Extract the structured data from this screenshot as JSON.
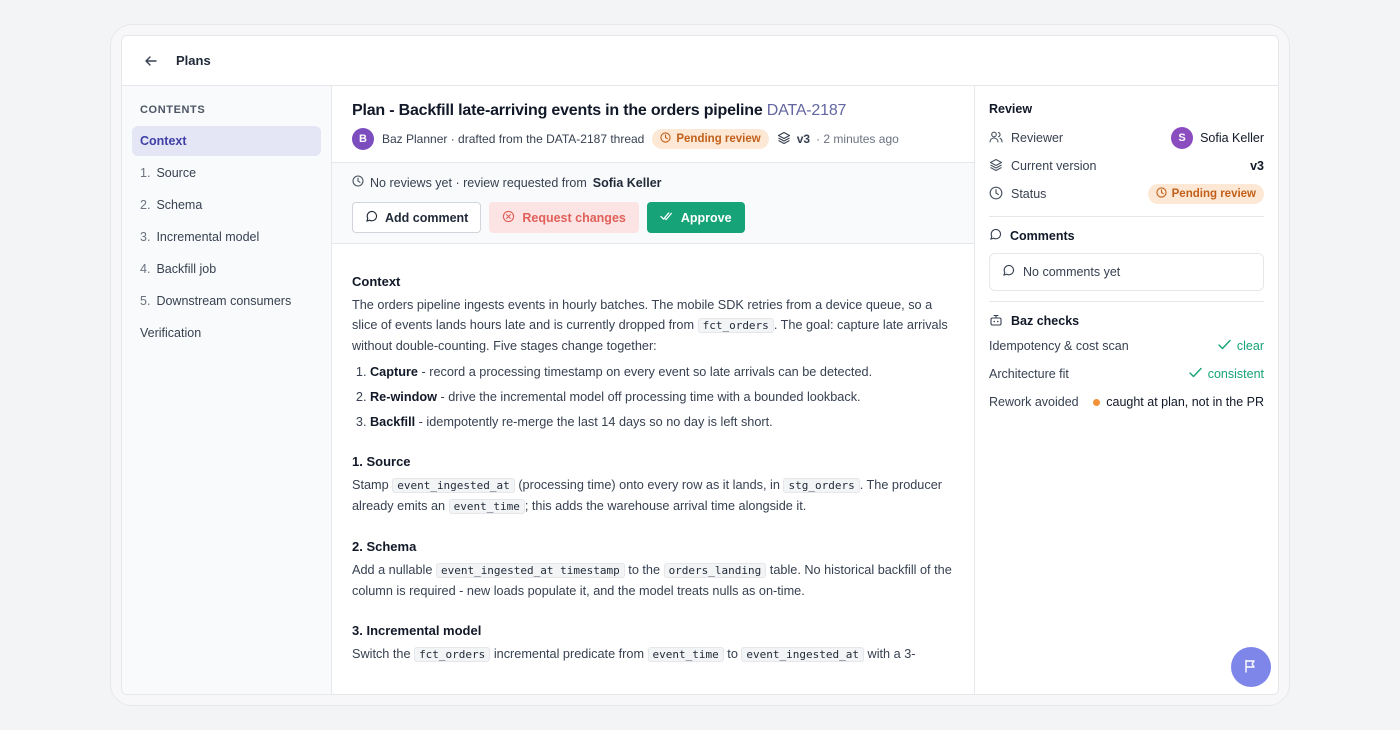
{
  "topbar": {
    "back_icon": "arrow-left-icon",
    "title": "Plans"
  },
  "sidebar": {
    "heading": "CONTENTS",
    "items": [
      {
        "num": "",
        "label": "Context",
        "active": true
      },
      {
        "num": "1.",
        "label": "Source"
      },
      {
        "num": "2.",
        "label": "Schema"
      },
      {
        "num": "3.",
        "label": "Incremental model"
      },
      {
        "num": "4.",
        "label": "Backfill job"
      },
      {
        "num": "5.",
        "label": "Downstream consumers"
      },
      {
        "num": "",
        "label": "Verification"
      }
    ]
  },
  "plan": {
    "title": "Plan - Backfill late-arriving events in the orders pipeline",
    "ticket": "DATA-2187",
    "author_initial": "B",
    "author_line": "Baz Planner · drafted from the DATA-2187 thread",
    "status": "Pending review",
    "version": "v3",
    "ago": "· 2 minutes ago"
  },
  "review_bar": {
    "text": "No reviews yet · review requested from",
    "reviewer": "Sofia Keller",
    "add_comment": "Add comment",
    "request_changes": "Request changes",
    "approve": "Approve"
  },
  "doc": {
    "context_h": "Context",
    "context_p1": "The orders pipeline ingests events in hourly batches. The mobile SDK retries from a device queue, so a slice of events lands hours late and is currently dropped from",
    "context_code": "fct_orders",
    "context_p2": ". The goal: capture late arrivals without double-counting. Five stages change together:",
    "list": [
      {
        "b": "Capture",
        "t": " - record a processing timestamp on every event so late arrivals can be detected."
      },
      {
        "b": "Re-window",
        "t": " - drive the incremental model off processing time with a bounded lookback."
      },
      {
        "b": "Backfill",
        "t": " - idempotently re-merge the last 14 days so no day is left short."
      }
    ],
    "source_h": "1. Source",
    "source_t1": "Stamp ",
    "source_c1": "event_ingested_at",
    "source_t2": " (processing time) onto every row as it lands, in ",
    "source_c2": "stg_orders",
    "source_t3": ". The producer already emits an ",
    "source_c3": "event_time",
    "source_t4": "; this adds the warehouse arrival time alongside it.",
    "schema_h": "2. Schema",
    "schema_t1": "Add a nullable ",
    "schema_c1": "event_ingested_at timestamp",
    "schema_t2": " to the ",
    "schema_c2": "orders_landing",
    "schema_t3": " table. No historical backfill of the column is required - new loads populate it, and the model treats nulls as on-time.",
    "inc_h": "3. Incremental model",
    "inc_t1": "Switch the ",
    "inc_c1": "fct_orders",
    "inc_t2": " incremental predicate from ",
    "inc_c2": "event_time",
    "inc_t3": " to ",
    "inc_c3": "event_ingested_at",
    "inc_t4": " with a 3-"
  },
  "review_panel": {
    "heading": "Review",
    "reviewer_label": "Reviewer",
    "reviewer_initial": "S",
    "reviewer_name": "Sofia Keller",
    "version_label": "Current version",
    "version_value": "v3",
    "status_label": "Status",
    "status_value": "Pending review",
    "comments_h": "Comments",
    "comments_empty": "No comments yet",
    "checks_h": "Baz checks",
    "checks": [
      {
        "label": "Idempotency & cost scan",
        "value": "clear"
      },
      {
        "label": "Architecture fit",
        "value": "consistent"
      },
      {
        "label": "Rework avoided",
        "value": "caught at plan, not in the PR"
      }
    ]
  },
  "colors": {
    "accent": "#16a377",
    "pending_bg": "#fde8d6",
    "pending_fg": "#c2601a",
    "active_nav": "#e4e6f6",
    "fab": "#7f86ea"
  },
  "fab": {
    "icon": "flag-icon"
  }
}
